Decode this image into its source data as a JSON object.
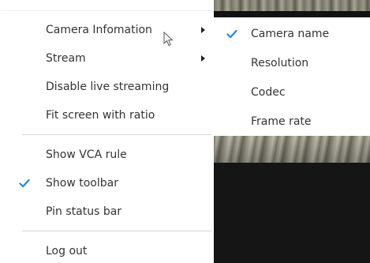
{
  "colors": {
    "accent": "#1e88e5",
    "text": "#333333",
    "separator": "#d6d6d6"
  },
  "main_menu": {
    "items": [
      {
        "label": "Camera Infomation",
        "submenu": true,
        "checked": false
      },
      {
        "label": "Stream",
        "submenu": true,
        "checked": false
      },
      {
        "label": "Disable live streaming",
        "submenu": false,
        "checked": false
      },
      {
        "label": "Fit screen with ratio",
        "submenu": false,
        "checked": false
      },
      {
        "label": "Show VCA rule",
        "submenu": false,
        "checked": false
      },
      {
        "label": "Show toolbar",
        "submenu": false,
        "checked": true
      },
      {
        "label": "Pin status bar",
        "submenu": false,
        "checked": false
      },
      {
        "label": "Log out",
        "submenu": false,
        "checked": false
      }
    ]
  },
  "sub_menu": {
    "items": [
      {
        "label": "Camera name",
        "checked": true
      },
      {
        "label": "Resolution",
        "checked": false
      },
      {
        "label": "Codec",
        "checked": false
      },
      {
        "label": "Frame rate",
        "checked": false
      }
    ]
  },
  "icons": {
    "check": "checkmark-icon",
    "submenu_arrow": "chevron-right-icon",
    "cursor": "mouse-pointer-icon"
  }
}
